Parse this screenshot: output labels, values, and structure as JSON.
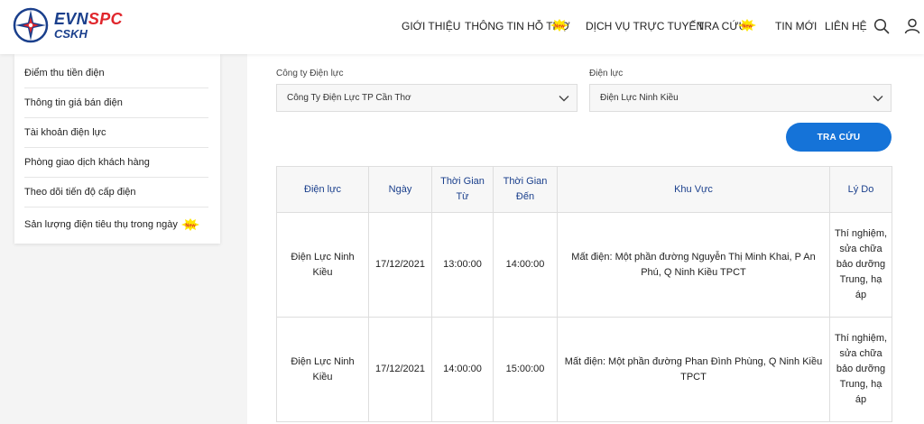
{
  "brand": {
    "line1_blue": "EVN",
    "line1_red": "SPC",
    "line2": "CSKH",
    "colors": {
      "blue": "#1a3f8c",
      "red": "#e0262c",
      "accent": "#1573d8"
    }
  },
  "nav": {
    "items": [
      {
        "label": "GIỚI THIỆU",
        "new": false
      },
      {
        "label": "THÔNG TIN HỖ TRỢ",
        "new": true
      },
      {
        "label": "DỊCH VỤ TRỰC TUYẾN",
        "new": false
      },
      {
        "label": "TRA CỨU",
        "new": true
      },
      {
        "label": "TIN MỚI",
        "new": false
      },
      {
        "label": "LIÊN HỆ",
        "new": false
      }
    ],
    "new_badge": "New",
    "icons": [
      "search-icon",
      "user-icon"
    ]
  },
  "sidebar": {
    "items": [
      {
        "label": "Điểm thu tiền điện"
      },
      {
        "label": "Thông tin giá bán điện"
      },
      {
        "label": "Tài khoản điện lực"
      },
      {
        "label": "Phòng giao dịch khách hàng"
      },
      {
        "label": "Theo dõi tiến độ cấp điện"
      },
      {
        "label": "Sản lượng điện tiêu thụ trong ngày",
        "new": true
      }
    ]
  },
  "form": {
    "company": {
      "label": "Công ty Điện lực",
      "value": "Công Ty Điện Lực TP Cần Thơ"
    },
    "branch": {
      "label": "Điện lực",
      "value": "Điện Lực Ninh Kiều"
    },
    "search_label": "TRA CỨU"
  },
  "table": {
    "headers": [
      "Điện lực",
      "Ngày",
      "Thời Gian Từ",
      "Thời Gian Đến",
      "Khu Vực",
      "Lý Do"
    ],
    "rows": [
      {
        "dien_luc": "Điện Lực Ninh Kiều",
        "ngay": "17/12/2021",
        "tu": "13:00:00",
        "den": "14:00:00",
        "khu_vuc": "Mất điện: Một phần đường Nguyễn Thị Minh Khai, P An Phú, Q Ninh Kiều TPCT",
        "ly_do": "Thí nghiệm, sửa chữa bảo dưỡng Trung, hạ áp"
      },
      {
        "dien_luc": "Điện Lực Ninh Kiều",
        "ngay": "17/12/2021",
        "tu": "14:00:00",
        "den": "15:00:00",
        "khu_vuc": "Mất điện: Một phần đường Phan Đình Phùng, Q Ninh Kiều TPCT",
        "ly_do": "Thí nghiệm, sửa chữa bảo dưỡng Trung, hạ áp"
      }
    ]
  }
}
